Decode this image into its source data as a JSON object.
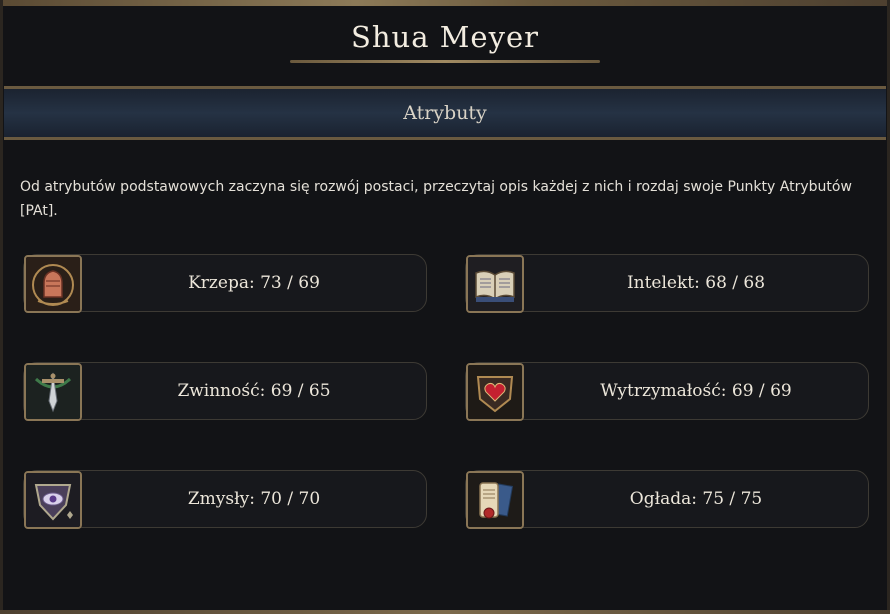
{
  "character": {
    "name": "Shua Meyer"
  },
  "section": {
    "title": "Atrybuty"
  },
  "description": "Od atrybutów podstawowych zaczyna się rozwój postaci, przeczytaj opis każdej z nich i rozdaj swoje Punkty Atrybutów [PAt].",
  "attributes": [
    {
      "label": "Krzepa: 73 / 69",
      "name": "Krzepa",
      "current": 73,
      "max": 69,
      "icon": "fist-icon"
    },
    {
      "label": "Intelekt: 68 / 68",
      "name": "Intelekt",
      "current": 68,
      "max": 68,
      "icon": "book-icon"
    },
    {
      "label": "Zwinność: 69 / 65",
      "name": "Zwinność",
      "current": 69,
      "max": 65,
      "icon": "sword-icon"
    },
    {
      "label": "Wytrzymałość: 69 / 69",
      "name": "Wytrzymałość",
      "current": 69,
      "max": 69,
      "icon": "heart-shield-icon"
    },
    {
      "label": "Zmysły: 70 / 70",
      "name": "Zmysły",
      "current": 70,
      "max": 70,
      "icon": "eye-shield-icon"
    },
    {
      "label": "Ogłada: 75 / 75",
      "name": "Ogłada",
      "current": 75,
      "max": 75,
      "icon": "scroll-icon"
    }
  ],
  "colors": {
    "accent_gold": "#8a7656",
    "section_blue": "#253244",
    "background": "#121316"
  }
}
